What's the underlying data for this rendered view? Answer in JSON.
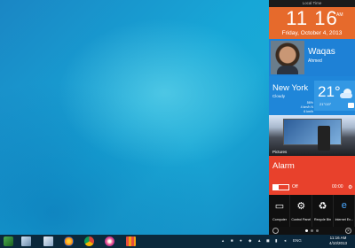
{
  "sidebar": {
    "header": "Local Time",
    "clock": {
      "time": "11 16",
      "ampm": "AM",
      "date": "Friday, October 4, 2013"
    },
    "user": {
      "first_name": "Waqas",
      "last_name": "Ahmed"
    },
    "weather": {
      "city": "New York",
      "condition": "Cloudy",
      "humidity": "56%",
      "wind": "4 km/h N",
      "feels": "6 km/h",
      "temp": "21°",
      "hilo": "21°/19°"
    },
    "pictures": {
      "label": "Pictures"
    },
    "alarm": {
      "title": "Alarm",
      "state": "Off",
      "time": "00:00"
    },
    "quick": [
      {
        "label": "Computer",
        "icon": "computer-icon"
      },
      {
        "label": "Control Panel",
        "icon": "control-panel-icon"
      },
      {
        "label": "Recycle Bin",
        "icon": "recycle-bin-icon"
      },
      {
        "label": "Internet Ex...",
        "icon": "internet-explorer-icon"
      }
    ]
  },
  "taskbar": {
    "tray_lang": "ENG",
    "clock_time": "11:16 AM",
    "clock_date": "4/10/2013"
  },
  "colors": {
    "clock_tile": "#e66a2c",
    "user_tile": "#1e81d6",
    "weather_tile": "#1f86d9",
    "alarm_tile": "#e8412c",
    "taskbar": "#0a1a28"
  }
}
